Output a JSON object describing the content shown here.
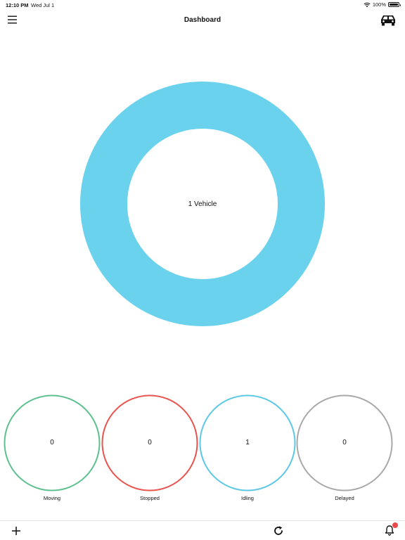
{
  "status_bar": {
    "time": "12:10 PM",
    "date": "Wed Jul 1",
    "battery_percent": "100%",
    "battery_level": 1.0,
    "wifi_icon": "wifi-icon"
  },
  "header": {
    "title": "Dashboard",
    "menu_icon": "menu-icon",
    "right_icon": "car-icon"
  },
  "main_chart": {
    "label": "1 Vehicle",
    "color": "#6bd2ed",
    "total": 1
  },
  "stats": [
    {
      "label": "Moving",
      "value": "0",
      "color": "#5dc08f"
    },
    {
      "label": "Stopped",
      "value": "0",
      "color": "#e9544f"
    },
    {
      "label": "Idling",
      "value": "1",
      "color": "#5cc8e6"
    },
    {
      "label": "Delayed",
      "value": "0",
      "color": "#a9a9a9"
    }
  ],
  "toolbar": {
    "add_icon": "plus-icon",
    "refresh_icon": "refresh-icon",
    "notifications_icon": "bell-icon",
    "badge_color": "#e94b4b"
  },
  "chart_data": {
    "type": "pie",
    "categories": [
      "Moving",
      "Stopped",
      "Idling",
      "Delayed"
    ],
    "values": [
      0,
      0,
      1,
      0
    ],
    "title": "",
    "center_label": "1 Vehicle"
  }
}
